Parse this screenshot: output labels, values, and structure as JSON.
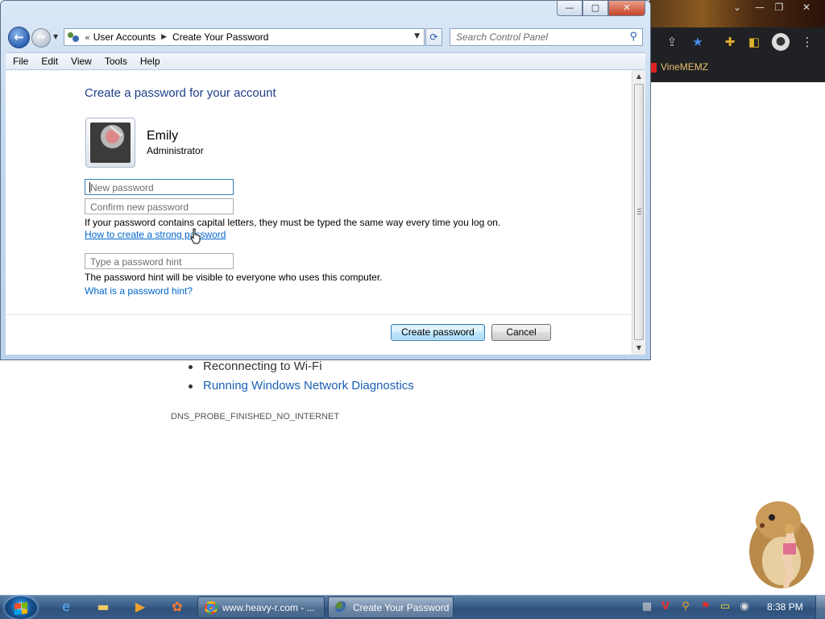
{
  "browser_background": {
    "bookmark_label": "VineMEMZ",
    "list_items": [
      "Reconnecting to Wi-Fi",
      "Running Windows Network Diagnostics"
    ],
    "error_code": "DNS_PROBE_FINISHED_NO_INTERNET"
  },
  "window": {
    "caption": {
      "minimize": "—",
      "maximize": "▢",
      "close": "✕"
    },
    "nav": {
      "back_glyph": "←",
      "forward_glyph": "→",
      "recent_glyph": "▼"
    },
    "address": {
      "chevron": "«",
      "crumbs": [
        "User Accounts",
        "Create Your Password"
      ],
      "separator": "▶",
      "dropdown_glyph": "▼"
    },
    "refresh_glyph": "⟳",
    "search": {
      "placeholder": "Search Control Panel",
      "icon_glyph": "⚲"
    },
    "menu": [
      "File",
      "Edit",
      "View",
      "Tools",
      "Help"
    ],
    "content": {
      "title": "Create a password for your account",
      "user": {
        "name": "Emily",
        "role": "Administrator"
      },
      "new_password_placeholder": "New password",
      "confirm_password_placeholder": "Confirm new password",
      "caps_note": "If your password contains capital letters, they must be typed the same way every time you log on.",
      "strong_password_link": "How to create a strong password",
      "hint_placeholder": "Type a password hint",
      "hint_note": "The password hint will be visible to everyone who uses this computer.",
      "hint_link": "What is a password hint?"
    },
    "buttons": {
      "create": "Create password",
      "cancel": "Cancel"
    },
    "scrollbar": {
      "up_glyph": "▲",
      "down_glyph": "▼"
    }
  },
  "taskbar": {
    "tasks": [
      {
        "label": "www.heavy-r.com - ..."
      },
      {
        "label": "Create Your Password"
      }
    ],
    "clock": "8:38 PM"
  },
  "colors": {
    "title_blue": "#1e3f8a",
    "link_blue": "#0066cc",
    "bookmark_text": "#e8c070",
    "taskbar": "#3a5f8a"
  }
}
